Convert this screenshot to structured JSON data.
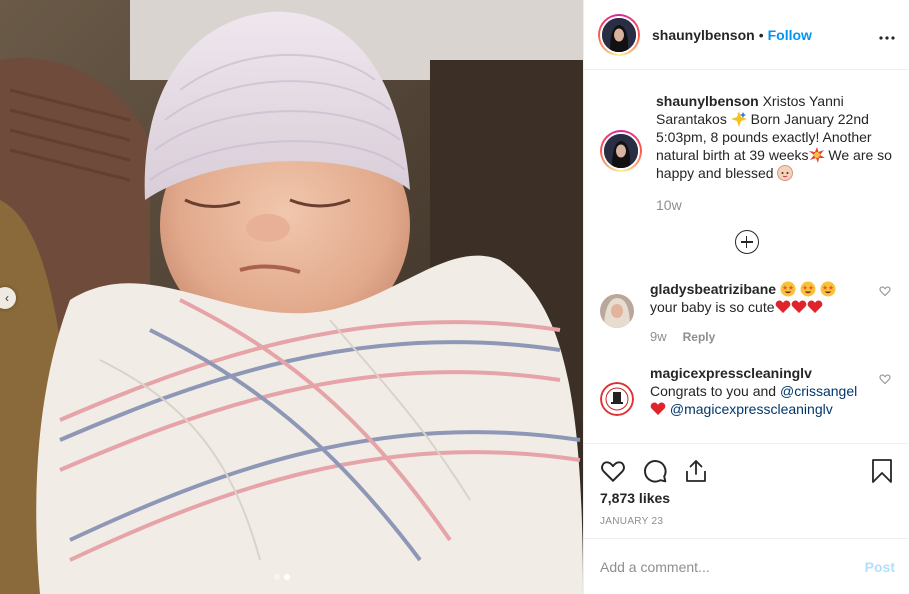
{
  "post": {
    "author": {
      "username": "shaunylbenson",
      "follow_label": "Follow",
      "separator": "•"
    },
    "more_icon": "more-horizontal-icon",
    "caption": {
      "username": "shaunylbenson",
      "segments": [
        " Xristos Yanni Sarantakos ",
        " Born January 22nd 5:03pm, 8 pounds exactly! Another natural birth at 39 weeks",
        " We are so happy and blessed "
      ],
      "emojis": [
        "sparkles-emoji",
        "collision-emoji",
        "baby-emoji"
      ],
      "age": "10w"
    },
    "load_more_icon": "plus-circle-icon",
    "comments": [
      {
        "username": "gladysbeatrizibane",
        "text": "your baby is so cute",
        "emojis_before": [
          "star-struck-emoji",
          "star-struck-emoji",
          "star-struck-emoji"
        ],
        "emojis_after": [
          "red-heart-emoji",
          "red-heart-emoji",
          "red-heart-emoji"
        ],
        "age": "9w",
        "reply_label": "Reply"
      },
      {
        "username": "magicexpresscleaninglv",
        "text_before": " Congrats to you and ",
        "mention_1": "@crissangel",
        "mention_2": "@magicexpresscleaninglv",
        "emoji": "red-heart-emoji"
      }
    ],
    "likes": "7,873 likes",
    "date": "JANUARY 23",
    "add_comment": {
      "placeholder": "Add a comment...",
      "post_label": "Post"
    },
    "colors": {
      "follow": "#0095f6",
      "post_disabled": "#b2dffc",
      "muted": "#8e8e8e",
      "link": "#00376b"
    },
    "carousel": {
      "slide_count": 2,
      "active_slide": 2
    }
  }
}
